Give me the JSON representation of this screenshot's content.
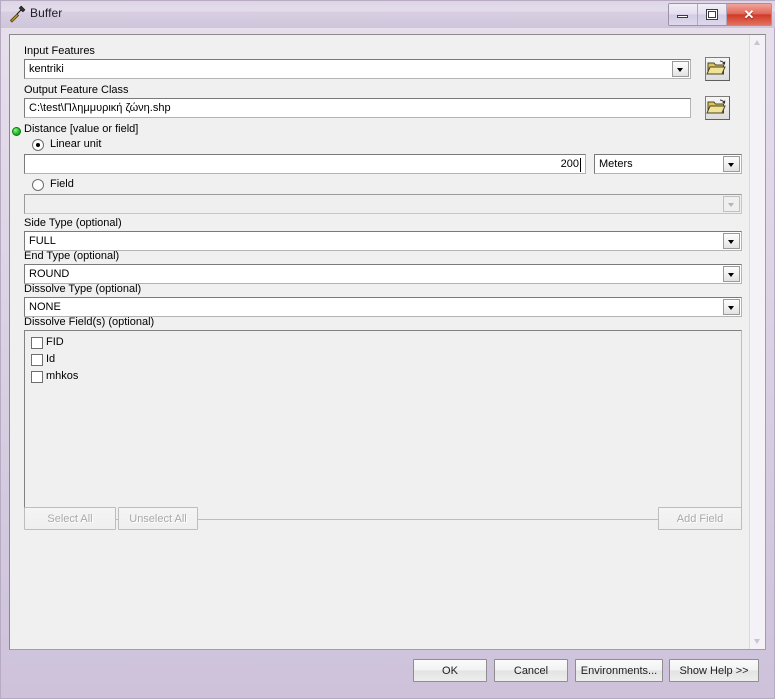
{
  "window": {
    "title": "Buffer",
    "icon": "hammer-tool-icon",
    "controls": {
      "minimize": "minimize-icon",
      "maximize": "restore-icon",
      "close": "✕"
    }
  },
  "form": {
    "input_features": {
      "label": "Input Features",
      "value": "kentriki",
      "browse": "folder-open-icon"
    },
    "output_feature_class": {
      "label": "Output Feature Class",
      "value": "C:\\test\\Πλημμυρική ζώνη.shp",
      "browse": "folder-open-icon"
    },
    "distance": {
      "label": "Distance [value or field]",
      "required_indicator": "green-dot-icon",
      "linear_unit": {
        "label": "Linear unit",
        "selected": true,
        "value": "200",
        "unit": "Meters"
      },
      "field": {
        "label": "Field",
        "selected": false,
        "value": ""
      }
    },
    "side_type": {
      "label": "Side Type (optional)",
      "value": "FULL"
    },
    "end_type": {
      "label": "End Type (optional)",
      "value": "ROUND"
    },
    "dissolve_type": {
      "label": "Dissolve Type (optional)",
      "value": "NONE"
    },
    "dissolve_fields": {
      "label": "Dissolve Field(s) (optional)",
      "items": [
        {
          "name": "FID",
          "checked": false
        },
        {
          "name": "Id",
          "checked": false
        },
        {
          "name": "mhkos",
          "checked": false
        }
      ]
    },
    "list_actions": {
      "select_all": "Select All",
      "unselect_all": "Unselect All",
      "add_field": "Add Field"
    }
  },
  "footer": {
    "ok": "OK",
    "cancel": "Cancel",
    "environments": "Environments...",
    "show_help": "Show Help >>"
  }
}
